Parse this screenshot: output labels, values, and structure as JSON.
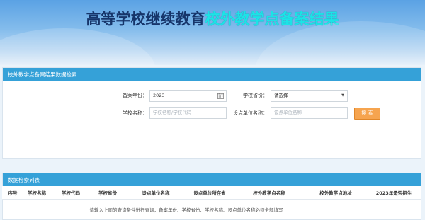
{
  "banner": {
    "title_part1": "高等学校继续教育",
    "title_part2": "校外教学点备案结果"
  },
  "search_panel": {
    "header": "校外教学点备案结果数据检索",
    "year_label": "备案年份：",
    "year_value": "2023",
    "province_label": "学校省份：",
    "province_value": "请选择",
    "school_name_label": "学校名称：",
    "school_name_placeholder": "学校名称/学校代码",
    "unit_label": "设点单位名称：",
    "unit_placeholder": "设点单位名称",
    "search_button": "搜 索"
  },
  "list_panel": {
    "header": "数据检索列表",
    "columns": [
      "序号",
      "学校名称",
      "学校代码",
      "学校省份",
      "设点单位名称",
      "设点单位所在省",
      "校外教学点名称",
      "校外教学点地址",
      "2023年是否招生"
    ],
    "empty_message": "请输入上面的查询条件进行查询，备案年份、学校省份、学校名称、设点单位名称必须全部填写"
  },
  "colors": {
    "header_bar": "#35a1d8",
    "search_button": "#f6a44f",
    "title_dark": "#16356a",
    "title_accent": "#1ce3e6"
  }
}
